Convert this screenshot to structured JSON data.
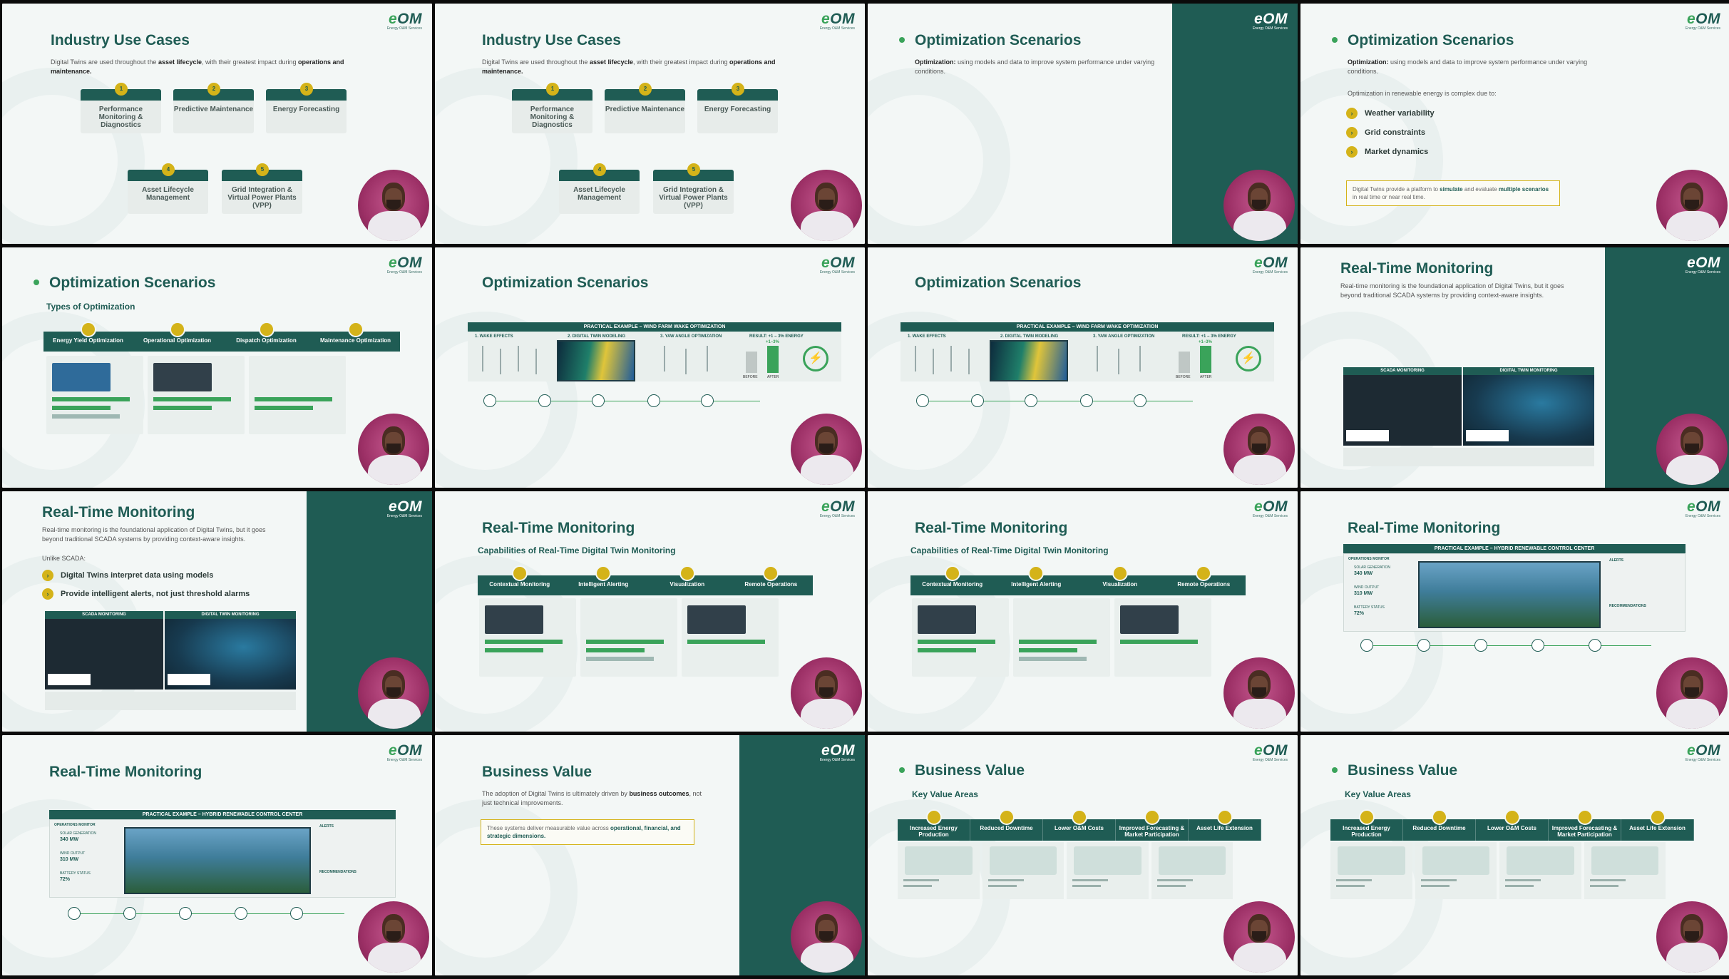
{
  "brand": {
    "logo_text": "eOM",
    "logo_tagline": "Energy O&M Services"
  },
  "colors": {
    "primary": "#1f5c54",
    "accent_gold": "#d4b319",
    "accent_green": "#3aa35a"
  },
  "slides": {
    "s1": {
      "title": "Industry Use Cases",
      "intro_a": "Digital Twins are used throughout the ",
      "intro_b": "asset lifecycle",
      "intro_c": ", with their greatest impact during ",
      "intro_d": "operations and maintenance.",
      "cards": [
        {
          "num": "1",
          "label": "Performance Monitoring & Diagnostics"
        },
        {
          "num": "2",
          "label": "Predictive Maintenance"
        },
        {
          "num": "3",
          "label": "Energy Forecasting"
        },
        {
          "num": "4",
          "label": "Asset Lifecycle Management"
        },
        {
          "num": "5",
          "label": "Grid Integration & Virtual Power Plants (VPP)"
        }
      ]
    },
    "opt": {
      "title": "Optimization Scenarios",
      "def_a": "Optimization:",
      "def_b": " using models and data to improve system performance under varying conditions.",
      "complex": "Optimization in renewable energy is complex due to:",
      "bullets": [
        "Weather variability",
        "Grid constraints",
        "Market dynamics"
      ],
      "callout_a": "Digital Twins provide a platform to ",
      "callout_b": "simulate",
      "callout_c": " and evaluate ",
      "callout_d": "multiple scenarios",
      "callout_e": " in real time or near real time.",
      "types_heading": "Types of Optimization",
      "types": [
        "Energy Yield Optimization",
        "Operational Optimization",
        "Dispatch Optimization",
        "Maintenance Optimization"
      ],
      "example_title": "PRACTICAL EXAMPLE – WIND FARM WAKE OPTIMIZATION",
      "example_steps": [
        "1. WAKE EFFECTS",
        "2. DIGITAL TWIN MODELING",
        "3. YAW ANGLE OPTIMIZATION",
        "RESULT: +1 – 3% ENERGY"
      ],
      "before": "BEFORE",
      "after": "AFTER",
      "gain": "+1–3%"
    },
    "rtm": {
      "title": "Real-Time Monitoring",
      "intro": "Real-time monitoring is the foundational application of Digital Twins, but it goes beyond traditional SCADA systems by providing context-aware insights.",
      "unlike": "Unlike SCADA:",
      "bullets": [
        "Digital Twins interpret data using models",
        "Provide intelligent alerts, not just threshold alarms"
      ],
      "scada_label": "SCADA MONITORING",
      "dt_label": "DIGITAL TWIN MONITORING",
      "caps_heading": "Capabilities of Real-Time Digital Twin Monitoring",
      "caps": [
        "Contextual Monitoring",
        "Intelligent Alerting",
        "Visualization",
        "Remote Operations"
      ],
      "hybrid_title": "PRACTICAL EXAMPLE – HYBRID RENEWABLE CONTROL CENTER",
      "ops_monitor": "OPERATIONS MONITOR",
      "solar_gen": "SOLAR GENERATION",
      "solar_val": "340 MW",
      "wind_out": "WIND OUTPUT",
      "wind_val": "310 MW",
      "battery": "BATTERY STATUS",
      "battery_val": "72%",
      "alerts": "ALERTS",
      "recs": "RECOMMENDATIONS"
    },
    "bv": {
      "title": "Business Value",
      "intro_a": "The adoption of Digital Twins is ultimately driven by ",
      "intro_b": "business outcomes",
      "intro_c": ", not just technical improvements.",
      "callout_a": "These systems deliver measurable value across ",
      "callout_b": "operational, financial, and strategic dimensions.",
      "areas_heading": "Key Value Areas",
      "areas": [
        "Increased Energy Production",
        "Reduced Downtime",
        "Lower O&M Costs",
        "Improved Forecasting & Market Participation",
        "Asset Life Extension"
      ]
    }
  }
}
